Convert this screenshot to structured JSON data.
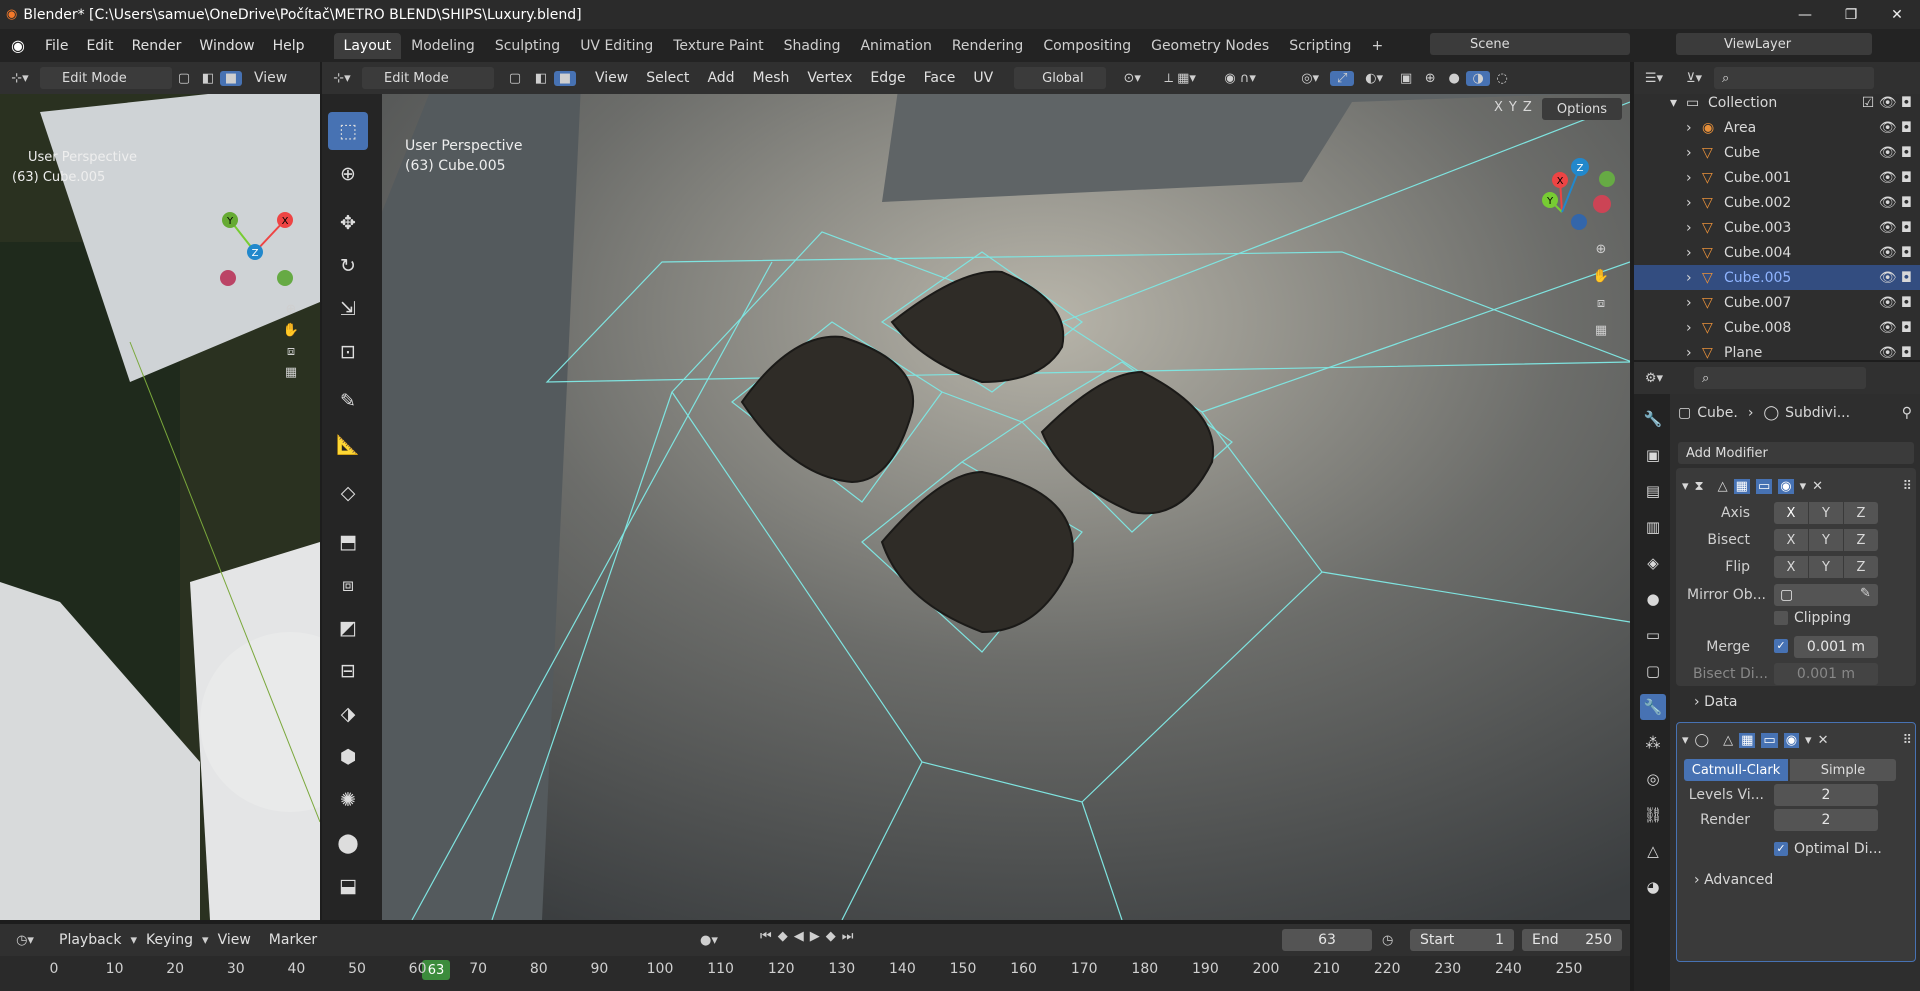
{
  "title": "Blender* [C:\\Users\\samue\\OneDrive\\Počítač\\METRO BLEND\\SHIPS\\Luxury.blend]",
  "menu": [
    "File",
    "Edit",
    "Render",
    "Window",
    "Help"
  ],
  "workspaces": [
    "Layout",
    "Modeling",
    "Sculpting",
    "UV Editing",
    "Texture Paint",
    "Shading",
    "Animation",
    "Rendering",
    "Compositing",
    "Geometry Nodes",
    "Scripting"
  ],
  "scene": "Scene",
  "view_layer": "ViewLayer",
  "left_view": {
    "mode": "Edit Mode",
    "view_label": "View",
    "persp": "User Perspective",
    "obj": "(63) Cube.005"
  },
  "main_view": {
    "mode": "Edit Mode",
    "menus": [
      "View",
      "Select",
      "Add",
      "Mesh",
      "Vertex",
      "Edge",
      "Face",
      "UV"
    ],
    "orientation": "Global",
    "persp": "User Perspective",
    "obj": "(63) Cube.005",
    "options": "Options",
    "x": "X",
    "y": "Y",
    "z": "Z"
  },
  "outliner": {
    "collection": "Collection",
    "items": [
      "Area",
      "Cube",
      "Cube.001",
      "Cube.002",
      "Cube.003",
      "Cube.004",
      "Cube.005",
      "Cube.007",
      "Cube.008",
      "Plane"
    ],
    "selected": "Cube.005"
  },
  "properties": {
    "breadcrumb_obj": "Cube.",
    "breadcrumb_mod": "Subdivi...",
    "add_modifier": "Add Modifier",
    "mirror": {
      "axis": "Axis",
      "bisect": "Bisect",
      "flip": "Flip",
      "mirror_ob": "Mirror Ob...",
      "clipping": "Clipping",
      "merge": "Merge",
      "merge_val": "0.001 m",
      "bisect_dist": "Bisect Di...",
      "bisect_val": "0.001 m",
      "data": "Data"
    },
    "subsurf": {
      "catmull": "Catmull-Clark",
      "simple": "Simple",
      "levels": "Levels Vi...",
      "levels_val": "2",
      "render": "Render",
      "render_val": "2",
      "optimal": "Optimal Di...",
      "advanced": "Advanced"
    }
  },
  "timeline": {
    "menus": [
      "Playback",
      "Keying",
      "View",
      "Marker"
    ],
    "frame": "63",
    "start_label": "Start",
    "start": "1",
    "end_label": "End",
    "end": "250",
    "ticks": [
      "0",
      "10",
      "20",
      "30",
      "40",
      "50",
      "60",
      "70",
      "80",
      "90",
      "100",
      "110",
      "120",
      "130",
      "140",
      "150",
      "160",
      "170",
      "180",
      "190",
      "200",
      "210",
      "220",
      "230",
      "240",
      "250"
    ],
    "current": "63"
  }
}
